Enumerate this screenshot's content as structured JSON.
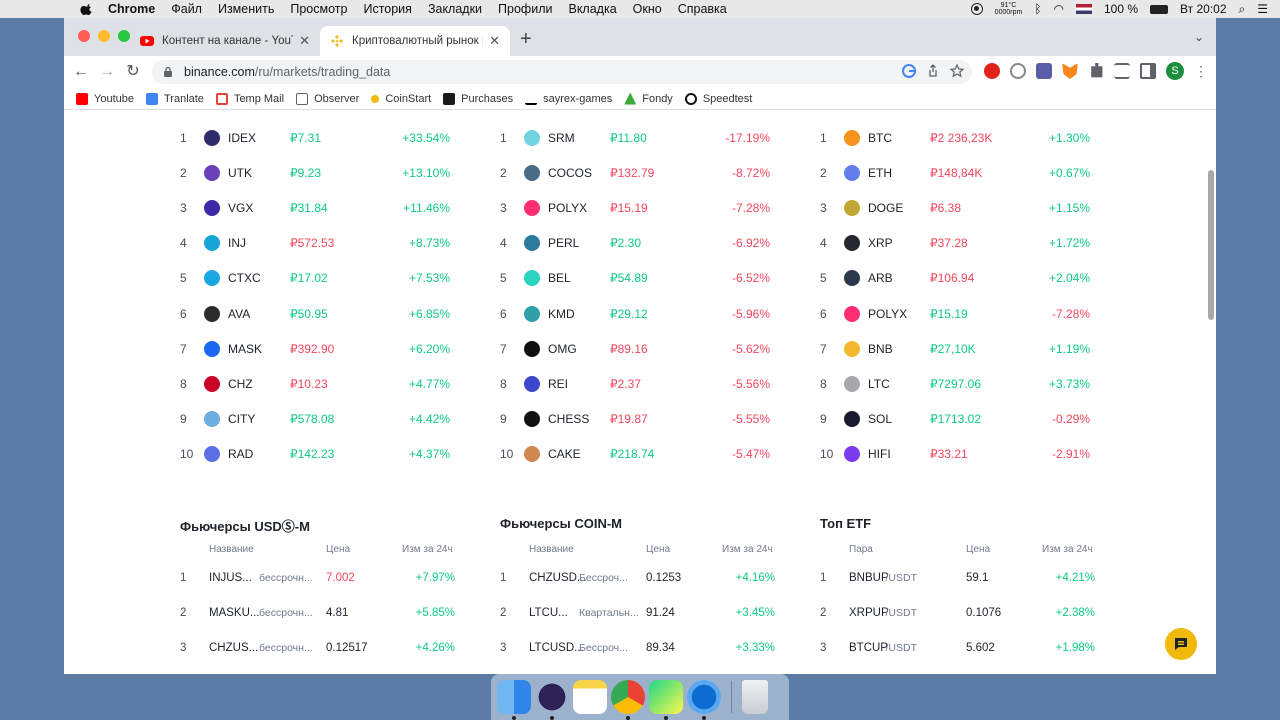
{
  "menubar": {
    "app": "Chrome",
    "items": [
      "Файл",
      "Изменить",
      "Просмотр",
      "История",
      "Закладки",
      "Профили",
      "Вкладка",
      "Окно",
      "Справка"
    ],
    "temp": "91°C",
    "rpm": "0000rpm",
    "battery": "100 %",
    "clock": "Вт 20:02"
  },
  "tabs": [
    {
      "title": "Контент на канале - YouTube",
      "active": false
    },
    {
      "title": "Криптовалютный рынок | Цен",
      "active": true
    }
  ],
  "address": {
    "host": "binance.com",
    "path": "/ru/markets/trading_data"
  },
  "bookmarks": [
    "Youtube",
    "Tranlate",
    "Temp Mail",
    "Observer",
    "CoinStart",
    "Purchases",
    "sayrex-games",
    "Fondy",
    "Speedtest"
  ],
  "profile_initial": "S",
  "movers": [
    {
      "column": "gainers",
      "rows": [
        {
          "rank": "1",
          "symbol": "IDEX",
          "price": "₽7.31",
          "change": "+33.54%",
          "price_color": "green",
          "change_color": "green",
          "icon_color": "#2d2d6b"
        },
        {
          "rank": "2",
          "symbol": "UTK",
          "price": "₽9.23",
          "change": "+13.10%",
          "price_color": "green",
          "change_color": "green",
          "icon_color": "#6b3fb7"
        },
        {
          "rank": "3",
          "symbol": "VGX",
          "price": "₽31.84",
          "change": "+11.46%",
          "price_color": "green",
          "change_color": "green",
          "icon_color": "#3b2aa8"
        },
        {
          "rank": "4",
          "symbol": "INJ",
          "price": "₽572.53",
          "change": "+8.73%",
          "price_color": "red",
          "change_color": "green",
          "icon_color": "#17a5d8"
        },
        {
          "rank": "5",
          "symbol": "CTXC",
          "price": "₽17.02",
          "change": "+7.53%",
          "price_color": "green",
          "change_color": "green",
          "icon_color": "#1aa6e0"
        },
        {
          "rank": "6",
          "symbol": "AVA",
          "price": "₽50.95",
          "change": "+6.85%",
          "price_color": "green",
          "change_color": "green",
          "icon_color": "#2b2b2b"
        },
        {
          "rank": "7",
          "symbol": "MASK",
          "price": "₽392.90",
          "change": "+6.20%",
          "price_color": "red",
          "change_color": "green",
          "icon_color": "#1c68f3"
        },
        {
          "rank": "8",
          "symbol": "CHZ",
          "price": "₽10.23",
          "change": "+4.77%",
          "price_color": "red",
          "change_color": "green",
          "icon_color": "#cd0124"
        },
        {
          "rank": "9",
          "symbol": "CITY",
          "price": "₽578.08",
          "change": "+4.42%",
          "price_color": "green",
          "change_color": "green",
          "icon_color": "#6caee0"
        },
        {
          "rank": "10",
          "symbol": "RAD",
          "price": "₽142.23",
          "change": "+4.37%",
          "price_color": "green",
          "change_color": "green",
          "icon_color": "#5b6ee1"
        }
      ]
    },
    {
      "column": "losers",
      "rows": [
        {
          "rank": "1",
          "symbol": "SRM",
          "price": "₽11.80",
          "change": "-17.19%",
          "price_color": "green",
          "change_color": "red",
          "icon_color": "#6fd3e0"
        },
        {
          "rank": "2",
          "symbol": "COCOS",
          "price": "₽132.79",
          "change": "-8.72%",
          "price_color": "red",
          "change_color": "red",
          "icon_color": "#4a6b85"
        },
        {
          "rank": "3",
          "symbol": "POLYX",
          "price": "₽15.19",
          "change": "-7.28%",
          "price_color": "red",
          "change_color": "red",
          "icon_color": "#ff2e72"
        },
        {
          "rank": "4",
          "symbol": "PERL",
          "price": "₽2.30",
          "change": "-6.92%",
          "price_color": "green",
          "change_color": "red",
          "icon_color": "#2c7a9e"
        },
        {
          "rank": "5",
          "symbol": "BEL",
          "price": "₽54.89",
          "change": "-6.52%",
          "price_color": "green",
          "change_color": "red",
          "icon_color": "#2bd4c1"
        },
        {
          "rank": "6",
          "symbol": "KMD",
          "price": "₽29.12",
          "change": "-5.96%",
          "price_color": "green",
          "change_color": "red",
          "icon_color": "#2f9fa9"
        },
        {
          "rank": "7",
          "symbol": "OMG",
          "price": "₽89.16",
          "change": "-5.62%",
          "price_color": "red",
          "change_color": "red",
          "icon_color": "#101010"
        },
        {
          "rank": "8",
          "symbol": "REI",
          "price": "₽2.37",
          "change": "-5.56%",
          "price_color": "red",
          "change_color": "red",
          "icon_color": "#3b48c9"
        },
        {
          "rank": "9",
          "symbol": "CHESS",
          "price": "₽19.87",
          "change": "-5.55%",
          "price_color": "red",
          "change_color": "red",
          "icon_color": "#111111"
        },
        {
          "rank": "10",
          "symbol": "CAKE",
          "price": "₽218.74",
          "change": "-5.47%",
          "price_color": "green",
          "change_color": "red",
          "icon_color": "#d1884f"
        }
      ]
    },
    {
      "column": "volume",
      "rows": [
        {
          "rank": "1",
          "symbol": "BTC",
          "price": "₽2 236,23K",
          "change": "+1.30%",
          "price_color": "red",
          "change_color": "green",
          "icon_color": "#f7931a"
        },
        {
          "rank": "2",
          "symbol": "ETH",
          "price": "₽148,84K",
          "change": "+0.67%",
          "price_color": "red",
          "change_color": "green",
          "icon_color": "#627eea"
        },
        {
          "rank": "3",
          "symbol": "DOGE",
          "price": "₽6.38",
          "change": "+1.15%",
          "price_color": "red",
          "change_color": "green",
          "icon_color": "#c2a633"
        },
        {
          "rank": "4",
          "symbol": "XRP",
          "price": "₽37.28",
          "change": "+1.72%",
          "price_color": "red",
          "change_color": "green",
          "icon_color": "#23292f"
        },
        {
          "rank": "5",
          "symbol": "ARB",
          "price": "₽106.94",
          "change": "+2.04%",
          "price_color": "red",
          "change_color": "green",
          "icon_color": "#2d374b"
        },
        {
          "rank": "6",
          "symbol": "POLYX",
          "price": "₽15.19",
          "change": "-7.28%",
          "price_color": "green",
          "change_color": "red",
          "icon_color": "#ff2e72"
        },
        {
          "rank": "7",
          "symbol": "BNB",
          "price": "₽27,10K",
          "change": "+1.19%",
          "price_color": "green",
          "change_color": "green",
          "icon_color": "#f3ba2f"
        },
        {
          "rank": "8",
          "symbol": "LTC",
          "price": "₽7297.06",
          "change": "+3.73%",
          "price_color": "green",
          "change_color": "green",
          "icon_color": "#a6a9aa"
        },
        {
          "rank": "9",
          "symbol": "SOL",
          "price": "₽1713.02",
          "change": "-0.29%",
          "price_color": "green",
          "change_color": "red",
          "icon_color": "#1a1a2e"
        },
        {
          "rank": "10",
          "symbol": "HIFI",
          "price": "₽33.21",
          "change": "-2.91%",
          "price_color": "red",
          "change_color": "red",
          "icon_color": "#7c3aed"
        }
      ]
    }
  ],
  "futures": [
    {
      "title": "Фьючерсы USDⓈ-M",
      "headers": {
        "name": "Название",
        "price": "Цена",
        "change": "Изм за 24ч"
      },
      "rows": [
        {
          "rank": "1",
          "name": "INJUS...",
          "sub": "бессрочн...",
          "price": "7.002",
          "change": "+7.97%",
          "price_color": "red"
        },
        {
          "rank": "2",
          "name": "MASKU...",
          "sub": "бессрочн...",
          "price": "4.81",
          "change": "+5.85%",
          "price_color": "dark"
        },
        {
          "rank": "3",
          "name": "CHZUS...",
          "sub": "бессрочн...",
          "price": "0.12517",
          "change": "+4.26%",
          "price_color": "dark"
        }
      ]
    },
    {
      "title": "Фьючерсы COIN-M",
      "headers": {
        "name": "Название",
        "price": "Цена",
        "change": "Изм за 24ч"
      },
      "rows": [
        {
          "rank": "1",
          "name": "CHZUSD...",
          "sub": "Бессроч...",
          "price": "0.1253",
          "change": "+4.16%",
          "price_color": "dark"
        },
        {
          "rank": "2",
          "name": "LTCU...",
          "sub": "Квартальн...",
          "price": "91.24",
          "change": "+3.45%",
          "price_color": "dark"
        },
        {
          "rank": "3",
          "name": "LTCUSD...",
          "sub": "Бессроч...",
          "price": "89.34",
          "change": "+3.33%",
          "price_color": "dark"
        }
      ]
    },
    {
      "title": "Топ ETF",
      "headers": {
        "name": "Пара",
        "price": "Цена",
        "change": "Изм за 24ч"
      },
      "rows": [
        {
          "rank": "1",
          "name": "BNBUP",
          "sub": "/USDT",
          "price": "59.1",
          "change": "+4.21%",
          "price_color": "dark"
        },
        {
          "rank": "2",
          "name": "XRPUP",
          "sub": "/USDT",
          "price": "0.1076",
          "change": "+2.38%",
          "price_color": "dark"
        },
        {
          "rank": "3",
          "name": "BTCUP",
          "sub": "/USDT",
          "price": "5.602",
          "change": "+1.98%",
          "price_color": "dark"
        }
      ]
    }
  ],
  "colors": {
    "green": "#0ecb81",
    "red": "#f6465d",
    "brand": "#f0b90b"
  }
}
